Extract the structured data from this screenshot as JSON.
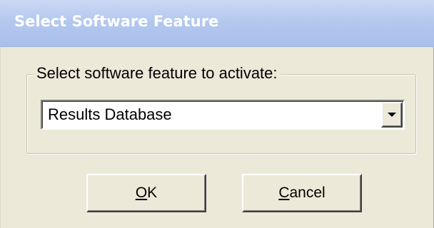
{
  "window": {
    "title": "Select Software Feature"
  },
  "group": {
    "label": "Select software feature to activate:"
  },
  "feature_select": {
    "selected_value": "Results Database"
  },
  "buttons": {
    "ok": {
      "mnemonic": "O",
      "rest": "K"
    },
    "cancel": {
      "mnemonic": "C",
      "rest": "ancel"
    }
  },
  "icons": {
    "dropdown": "chevron-down-icon"
  },
  "colors": {
    "dialog_face": "#ece9d8",
    "titlebar": "#b4c8ef",
    "title_text": "#ffffff"
  }
}
